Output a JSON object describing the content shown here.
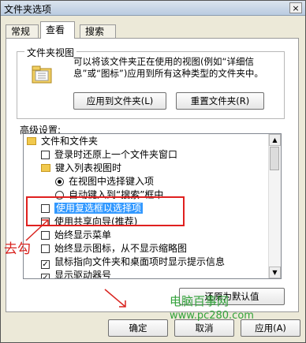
{
  "window": {
    "title": "文件夹选项",
    "close_glyph": "×"
  },
  "tabs": [
    {
      "label": "常规"
    },
    {
      "label": "查看"
    },
    {
      "label": "搜索"
    }
  ],
  "folder_views": {
    "group_title": "文件夹视图",
    "description": "可以将该文件夹正在使用的视图(例如“详细信息”或“图标”)应用到所有这种类型的文件夹中。",
    "apply_button": "应用到文件夹(L)",
    "reset_button": "重置文件夹(R)"
  },
  "advanced": {
    "label": "高级设置:",
    "items": [
      {
        "kind": "folder",
        "text": "文件和文件夹"
      },
      {
        "kind": "checkbox",
        "checked": false,
        "text": "登录时还原上一个文件夹窗口"
      },
      {
        "kind": "folder",
        "text": "键入列表视图时"
      },
      {
        "kind": "radio",
        "checked": true,
        "text": "在视图中选择键入项"
      },
      {
        "kind": "radio",
        "checked": false,
        "text": "自动键入到“搜索”框中"
      },
      {
        "kind": "checkbox",
        "checked": false,
        "text": "使用复选框以选择项",
        "highlight": true
      },
      {
        "kind": "checkbox",
        "checked": false,
        "text": "使用共享向导(推荐)"
      },
      {
        "kind": "checkbox",
        "checked": false,
        "text": "始终显示菜单"
      },
      {
        "kind": "checkbox",
        "checked": false,
        "text": "始终显示图标，从不显示缩略图"
      },
      {
        "kind": "checkbox",
        "checked": true,
        "text": "鼠标指向文件夹和桌面项时显示提示信息"
      },
      {
        "kind": "checkbox",
        "checked": true,
        "text": "显示驱动器号"
      }
    ],
    "restore_button": "还原为默认值"
  },
  "footer": {
    "ok": "确定",
    "cancel": "取消",
    "apply": "应用(A)"
  },
  "annotation": {
    "text": "去勾",
    "color": "#d9241f"
  },
  "watermark": {
    "line1": "电脑百事网",
    "line2": "www.pc280.com"
  }
}
